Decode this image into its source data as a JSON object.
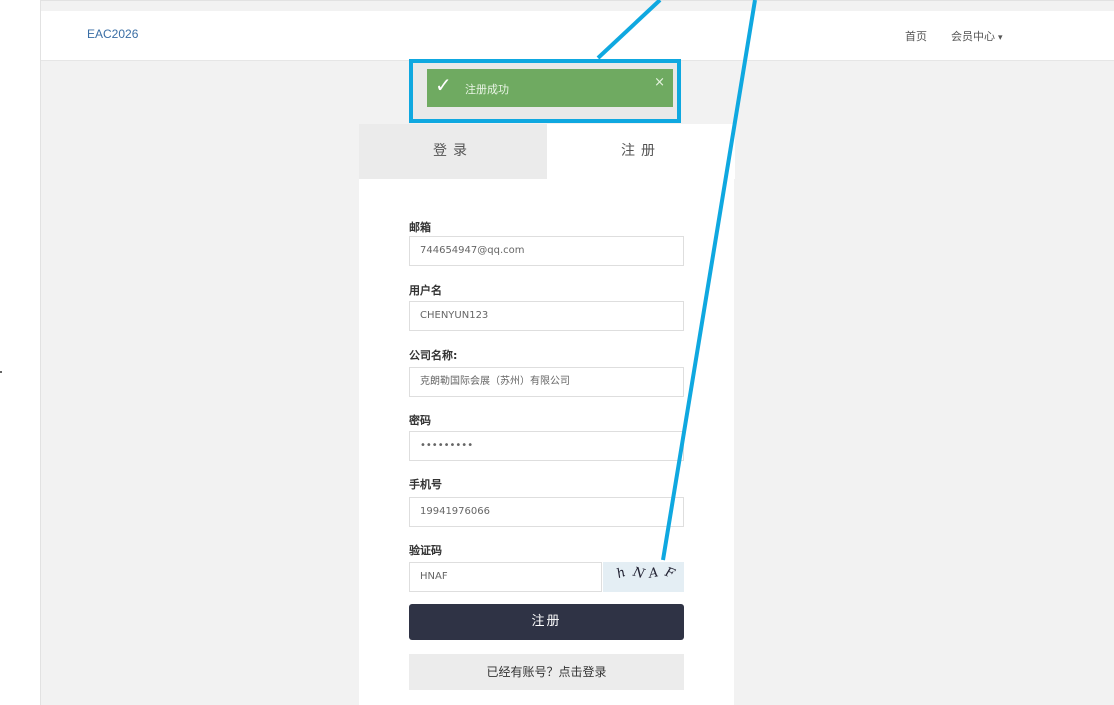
{
  "navbar": {
    "brand": "EAC2026",
    "home": "首页",
    "member_center": "会员中心",
    "caret": "▾"
  },
  "toast": {
    "message": "注册成功",
    "close": "×",
    "check": "✓"
  },
  "tabs": {
    "login": "登录",
    "register": "注册"
  },
  "form": {
    "email_label": "邮箱",
    "email_value": "744654947@qq.com",
    "username_label": "用户名",
    "username_value": "CHENYUN123",
    "company_label": "公司名称:",
    "company_value": "克朗勒国际会展（苏州）有限公司",
    "password_label": "密码",
    "password_value": "•••••••••",
    "phone_label": "手机号",
    "phone_value": "19941976066",
    "captcha_label": "验证码",
    "captcha_value": "HNAF",
    "captcha_image_text": [
      "h",
      "N",
      "A",
      "F"
    ]
  },
  "buttons": {
    "register": "注册",
    "go_login": "已经有账号？点击登录"
  },
  "colors": {
    "annotation": "#0fa8e0",
    "toast_success": "#6faa61",
    "primary_button": "#2f3345",
    "brand_link": "#3a6ea5"
  }
}
